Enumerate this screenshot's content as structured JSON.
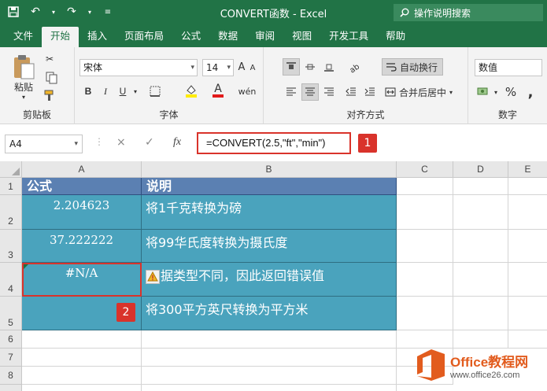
{
  "window": {
    "title": "CONVERT函数  -  Excel",
    "tell_me": "操作说明搜索"
  },
  "tabs": [
    "文件",
    "开始",
    "插入",
    "页面布局",
    "公式",
    "数据",
    "审阅",
    "视图",
    "开发工具",
    "帮助"
  ],
  "ribbon": {
    "clipboard": {
      "label": "剪贴板",
      "paste": "粘贴"
    },
    "font": {
      "label": "字体",
      "font_name": "宋体",
      "font_size": "14",
      "bold": "B",
      "italic": "I",
      "underline": "U",
      "font_color_glyph": "A",
      "phonetic_glyph": "wén"
    },
    "alignment": {
      "label": "对齐方式",
      "wrap_text": "自动换行",
      "merge_center": "合并后居中"
    },
    "number": {
      "label": "数字",
      "format": "数值",
      "percent": "%"
    }
  },
  "formula_bar": {
    "name_box": "A4",
    "formula": "=CONVERT(2.5,\"ft\",\"min\")",
    "badge": "1",
    "cancel": "×",
    "enter": "✓",
    "fx": "fx"
  },
  "grid": {
    "columns": [
      "A",
      "B",
      "C",
      "D",
      "E"
    ],
    "rows": [
      "1",
      "2",
      "3",
      "4",
      "5",
      "6",
      "7",
      "8"
    ],
    "header": {
      "a": "公式",
      "b": "说明"
    },
    "data": [
      {
        "a": "2.204623",
        "b": "将1千克转换为磅"
      },
      {
        "a": "37.222222",
        "b": "将99华氏度转换为摄氏度"
      },
      {
        "a": "#N/A",
        "b": "据类型不同，因此返回错误值"
      },
      {
        "a": "",
        "b": "将300平方英尺转换为平方米"
      }
    ],
    "badge2": "2"
  },
  "watermark": {
    "title": "Office教程网",
    "sub": "www.office26.com"
  },
  "colors": {
    "excel_green": "#217346",
    "teal_fill": "#4aa3bd",
    "header_fill": "#5b80b2",
    "callout_red": "#d9332b"
  }
}
